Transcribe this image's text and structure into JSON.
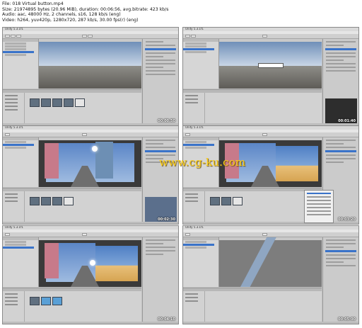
{
  "info": {
    "file": "File: 018 Virtual button.mp4",
    "size": "Size: 21974895 bytes (20.96 MiB), duration: 00:06:56, avg.bitrate: 423 kb/s",
    "audio": "Audio: aac, 48000 Hz, 2 channels, s16, 128 kb/s (eng)",
    "video": "Video: h264, yuv420p, 1280x720, 287 kb/s, 30.00 fps(r) (eng)"
  },
  "watermark": "www.cg-ku.com",
  "frames": [
    {
      "timestamp": "00:00:50",
      "title": "Unity 5.3.1f1"
    },
    {
      "timestamp": "00:01:40",
      "title": "Unity 5.3.1f1"
    },
    {
      "timestamp": "00:02:30",
      "title": "Unity 5.3.1f1"
    },
    {
      "timestamp": "00:03:20",
      "title": "Unity 5.3.1f1"
    },
    {
      "timestamp": "00:04:10",
      "title": "Unity 5.3.1f1"
    },
    {
      "timestamp": "00:05:00",
      "title": "Unity 5.3.1f1"
    }
  ],
  "menubar": [
    "File",
    "Edit",
    "Assets",
    "GameObject",
    "Component",
    "Window",
    "Help"
  ]
}
